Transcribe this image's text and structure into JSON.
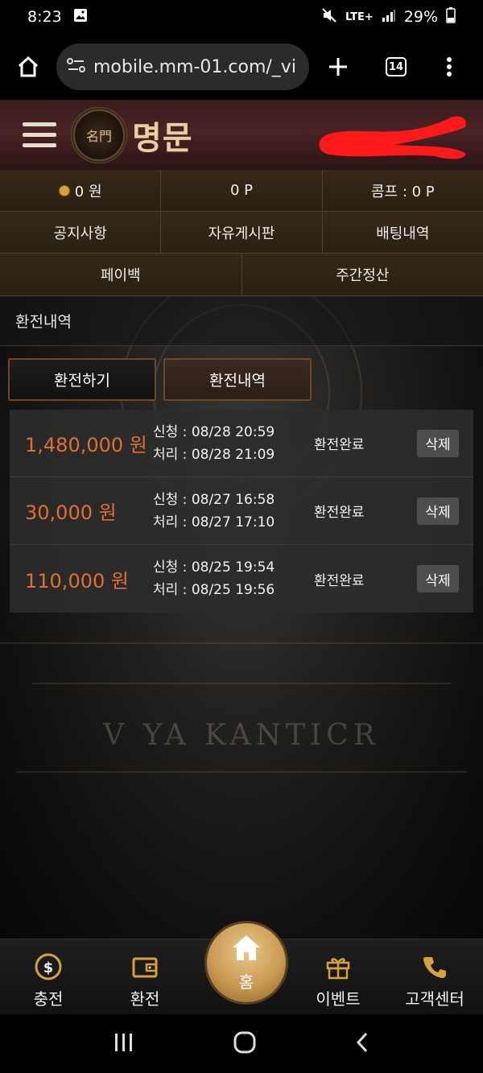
{
  "status_bar": {
    "time": "8:23",
    "network": "LTE+",
    "battery": "29%"
  },
  "browser": {
    "url": "mobile.mm-01.com/_vi",
    "tab_count": "14"
  },
  "site": {
    "brand": "명문",
    "logo_glyph": "名門"
  },
  "info": {
    "money": "0 원",
    "points": "0 P",
    "comp": "콤프 : 0 P"
  },
  "menu": {
    "row1": [
      "공지사항",
      "자유게시판",
      "배팅내역"
    ],
    "row2": [
      "페이백",
      "주간정산"
    ]
  },
  "page": {
    "title": "환전내역",
    "tab_exchange": "환전하기",
    "tab_history": "환전내역"
  },
  "records": [
    {
      "amount": "1,480,000 원",
      "requested": "신청 : 08/28 20:59",
      "processed": "처리 : 08/28 21:09",
      "status": "환전완료",
      "delete": "삭제"
    },
    {
      "amount": "30,000 원",
      "requested": "신청 : 08/27 16:58",
      "processed": "처리 : 08/27 17:10",
      "status": "환전완료",
      "delete": "삭제"
    },
    {
      "amount": "110,000 원",
      "requested": "신청 : 08/25 19:54",
      "processed": "처리 : 08/25 19:56",
      "status": "환전완료",
      "delete": "삭제"
    }
  ],
  "background_text": "V YA KANTICR",
  "bottom_nav": {
    "deposit": "충전",
    "withdraw": "환전",
    "home": "홈",
    "event": "이벤트",
    "support": "고객센터"
  },
  "colors": {
    "amount": "#e0702f",
    "gold": "#c99a52",
    "header_bg": "#4a2325"
  }
}
